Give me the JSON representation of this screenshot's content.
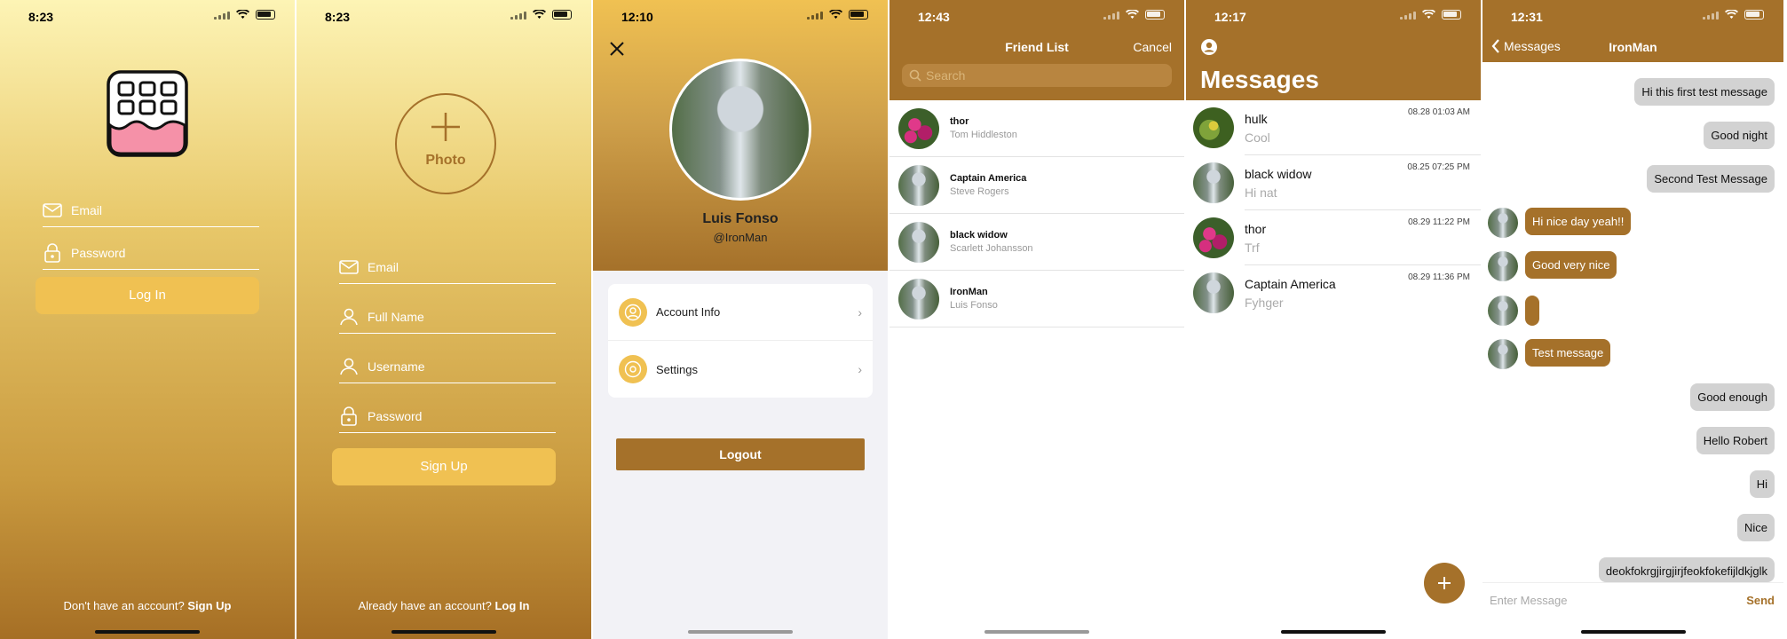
{
  "screens": {
    "login": {
      "time": "8:23",
      "email": "Email",
      "password": "Password",
      "login": "Log In",
      "footer_q": "Don't have an account?",
      "footer_link": "Sign Up"
    },
    "signup": {
      "time": "8:23",
      "photo": "Photo",
      "email": "Email",
      "fullname": "Full Name",
      "username": "Username",
      "password": "Password",
      "signup": "Sign Up",
      "footer_q": "Already have an account?",
      "footer_link": "Log In"
    },
    "profile": {
      "time": "12:10",
      "name": "Luis Fonso",
      "handle": "@IronMan",
      "menu": [
        {
          "label": "Account Info"
        },
        {
          "label": "Settings"
        }
      ],
      "logout": "Logout"
    },
    "friends": {
      "time": "12:43",
      "title": "Friend List",
      "cancel": "Cancel",
      "search_placeholder": "Search",
      "items": [
        {
          "name": "thor",
          "sub": "Tom Hiddleston"
        },
        {
          "name": "Captain America",
          "sub": "Steve Rogers"
        },
        {
          "name": "black widow",
          "sub": "Scarlett Johansson"
        },
        {
          "name": "IronMan",
          "sub": "Luis Fonso"
        }
      ]
    },
    "messages": {
      "time": "12:17",
      "title": "Messages",
      "items": [
        {
          "name": "hulk",
          "sub": "Cool",
          "date": "08.28 01:03 AM"
        },
        {
          "name": "black widow",
          "sub": "Hi nat",
          "date": "08.25 07:25 PM"
        },
        {
          "name": "thor",
          "sub": "Trf",
          "date": "08.29 11:22 PM"
        },
        {
          "name": "Captain America",
          "sub": "Fyhger",
          "date": "08.29 11:36 PM"
        }
      ]
    },
    "chat": {
      "time": "12:31",
      "back": "Messages",
      "title": "IronMan",
      "input_placeholder": "Enter Message",
      "send": "Send",
      "msgs": [
        {
          "t": "Hi this first test message"
        },
        {
          "t": "Good night"
        },
        {
          "t": "Second Test Message"
        },
        {
          "t": "Hi nice day yeah!!"
        },
        {
          "t": "Good very nice"
        },
        {
          "t": ""
        },
        {
          "t": "Test message"
        },
        {
          "t": "Good enough"
        },
        {
          "t": "Hello Robert"
        },
        {
          "t": "Hi"
        },
        {
          "t": "Nice"
        },
        {
          "t": "deokfokrgjirgjirjfeokfokefijldkjglk"
        }
      ]
    }
  },
  "colors": {
    "accent": "#a5712a",
    "button": "#f0c152",
    "bubble_me": "#d2d2d2"
  }
}
